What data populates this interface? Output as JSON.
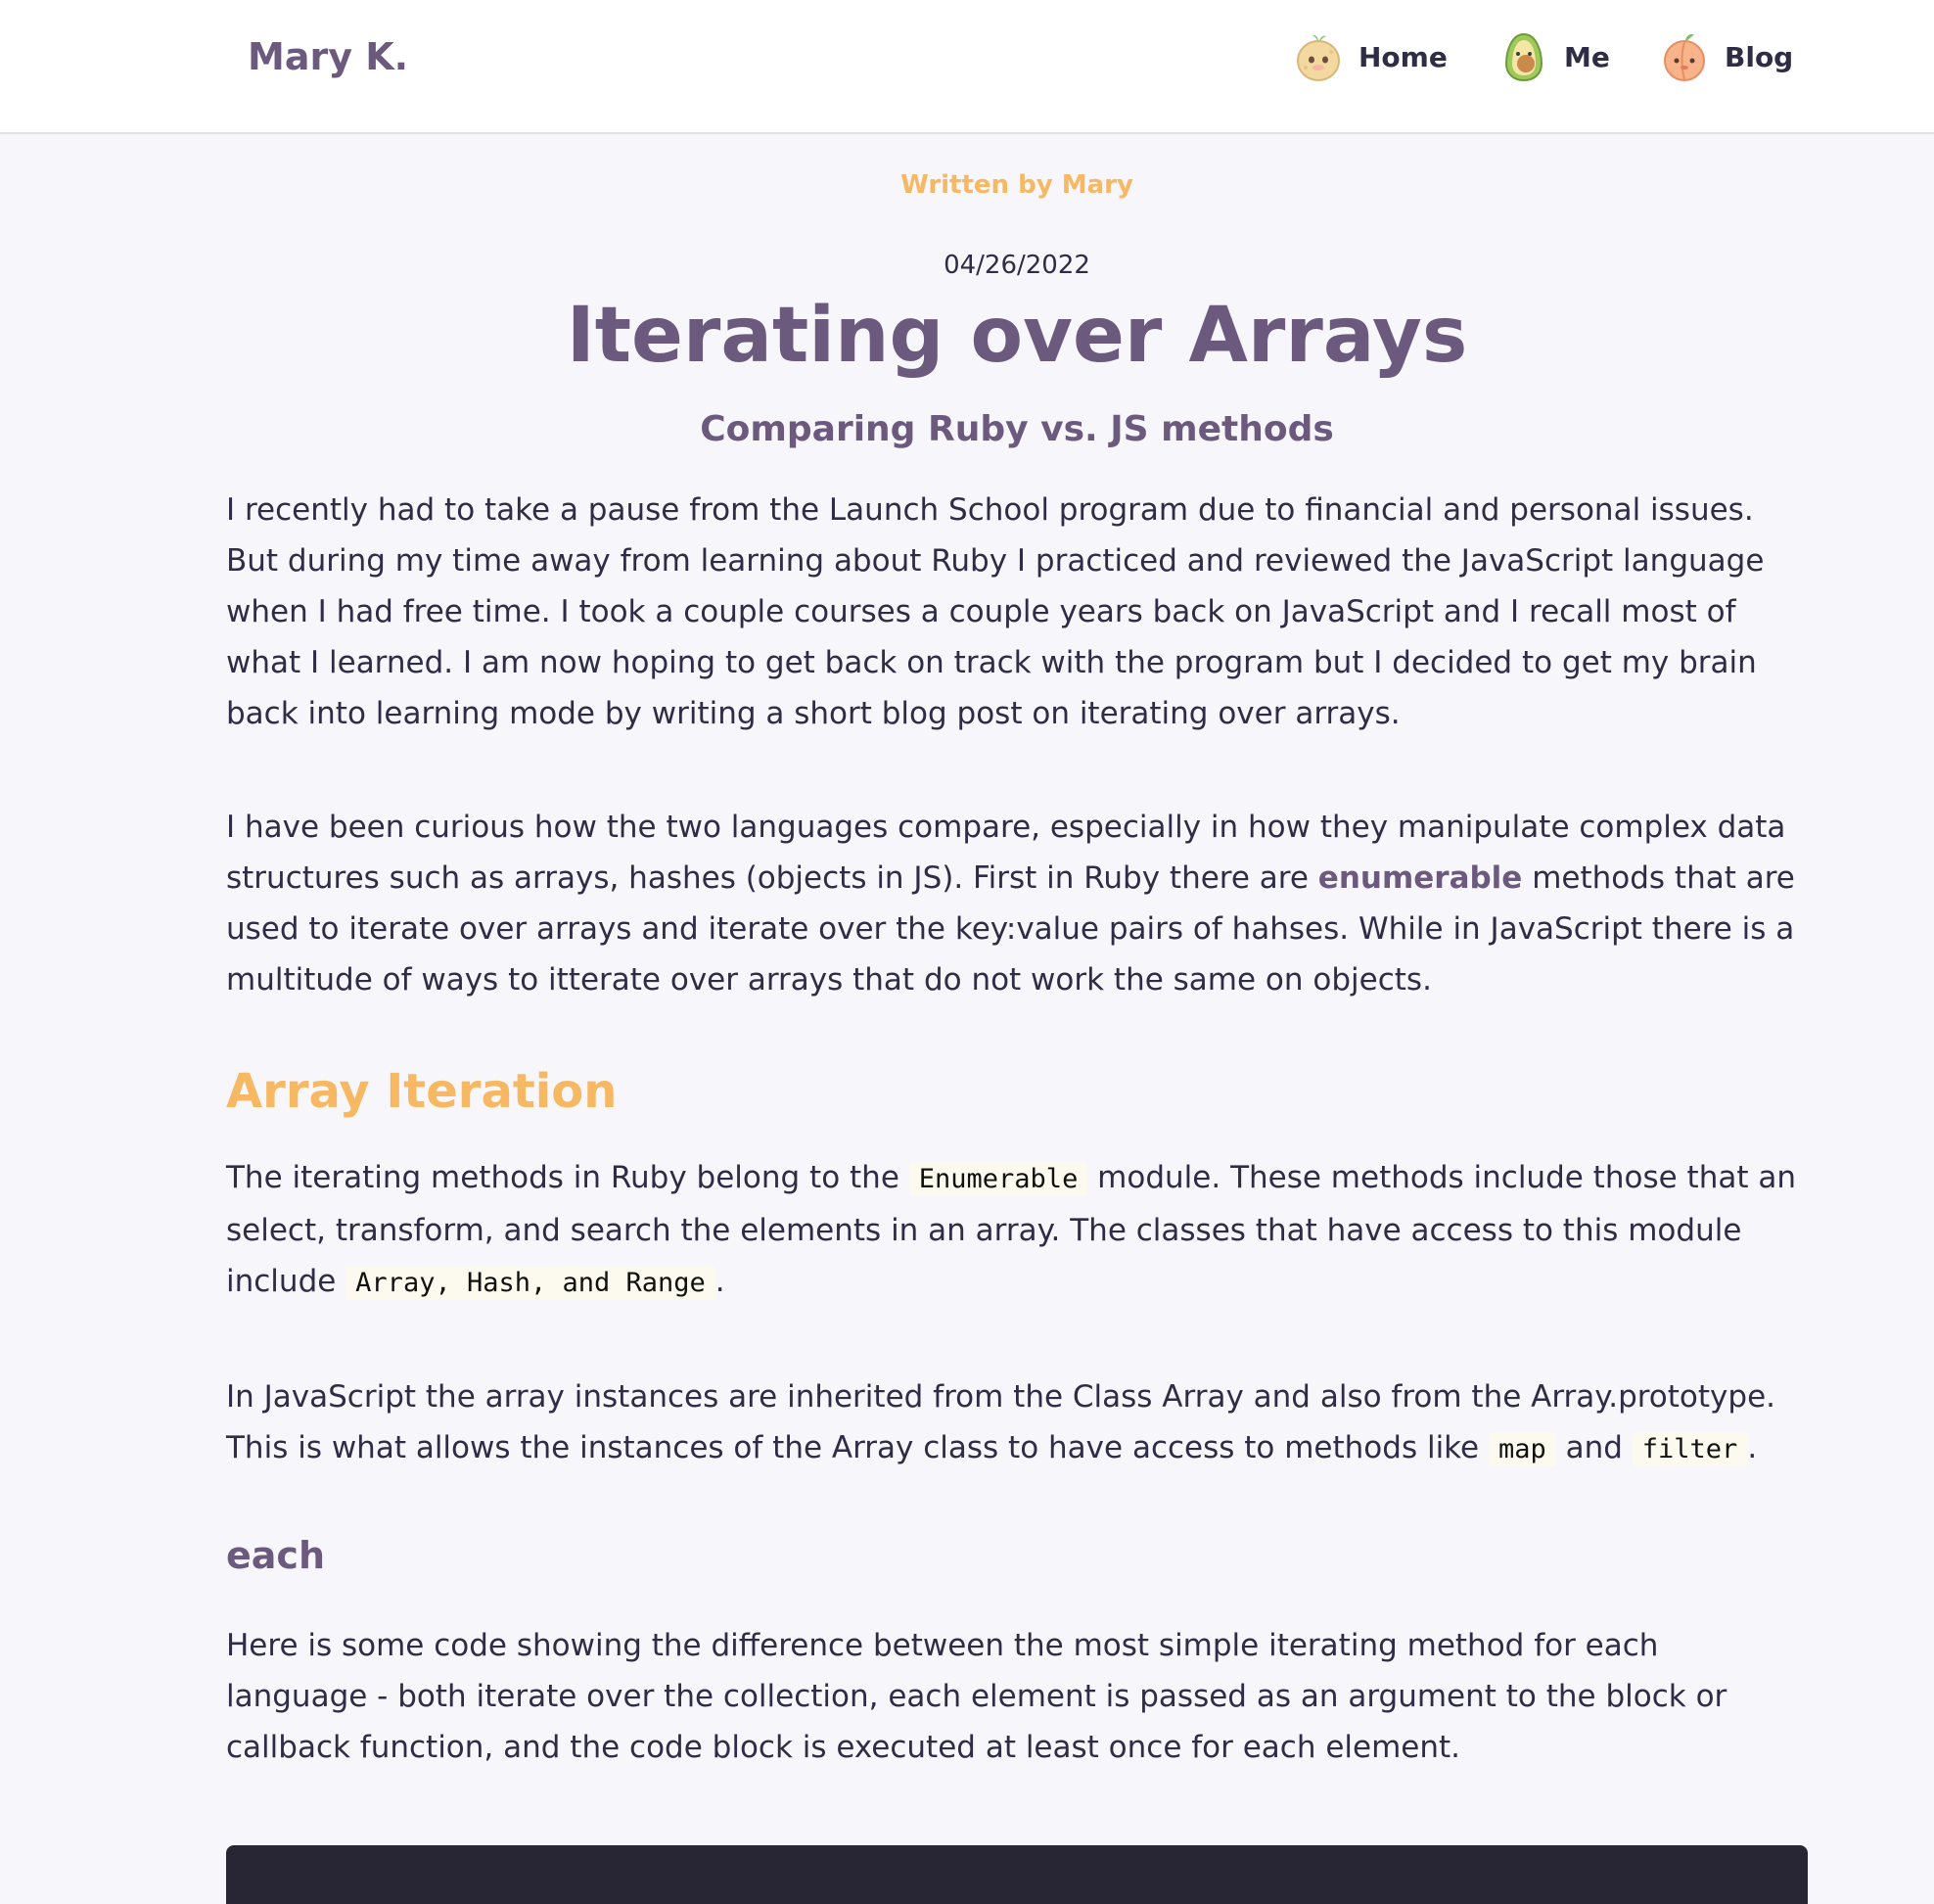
{
  "nav": {
    "brand": "Mary K.",
    "items": [
      {
        "label": "Home",
        "icon": "potato-mascot-icon"
      },
      {
        "label": "Me",
        "icon": "avocado-mascot-icon"
      },
      {
        "label": "Blog",
        "icon": "peach-mascot-icon"
      }
    ]
  },
  "article": {
    "byline": "Written by Mary",
    "date": "04/26/2022",
    "title": "Iterating over Arrays",
    "subtitle": "Comparing Ruby vs. JS methods",
    "paragraph1": "I recently had to take a pause from the Launch School program due to financial and personal issues. But during my time away from learning about Ruby I practiced and reviewed the JavaScript language when I had free time. I took a couple courses a couple years back on JavaScript and I recall most of what I learned. I am now hoping to get back on track with the program but I decided to get my brain back into learning mode by writing a short blog post on iterating over arrays.",
    "paragraph2": {
      "before": "I have been curious how the two languages compare, especially in how they manipulate complex data structures such as arrays, hashes (objects in JS). First in Ruby there are ",
      "strong": "enumerable",
      "after": " methods that are used to iterate over arrays and iterate over the key:value pairs of hahses. While in JavaScript there is a multitude of ways to itterate over arrays that do not work the same on objects."
    },
    "heading_array_iteration": "Array Iteration",
    "paragraph3": {
      "before": "The iterating methods in Ruby belong to the ",
      "code1": "Enumerable",
      "middle": " module. These methods include those that an select, transform, and search the elements in an array. The classes that have access to this module include ",
      "code2": "Array, Hash, and Range",
      "after": "."
    },
    "paragraph4": {
      "before": "In JavaScript the array instances are inherited from the Class Array and also from the Array.prototype. This is what allows the instances of the Array class to have access to methods like ",
      "code1": "map",
      "middle": " and ",
      "code2": "filter",
      "after": "."
    },
    "heading_each": "each",
    "paragraph5": "Here is some code showing the difference between the most simple iterating method for each language - both iterate over the collection, each element is passed as an argument to the block or callback function, and the code block is executed at least once for each element."
  },
  "colors": {
    "accent_purple": "#6b5a7e",
    "accent_orange": "#f6b863",
    "background": "#f7f6fa",
    "code_background": "#fcfaee",
    "code_block": "#282634"
  }
}
